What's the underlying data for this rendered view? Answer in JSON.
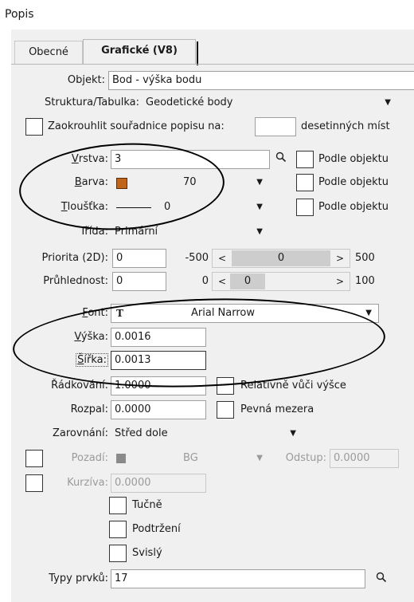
{
  "window": {
    "title": "Popis"
  },
  "tabs": [
    {
      "label": "Obecné"
    },
    {
      "label": "Grafické (V8)"
    }
  ],
  "objekt": {
    "label": "Objekt:",
    "value": "Bod - výška bodu"
  },
  "struktura": {
    "label": "Struktura/Tabulka:",
    "value": "Geodetické body"
  },
  "zaokrouhlit": {
    "label": "Zaokrouhlit souřadnice popisu na:",
    "value": "",
    "suffix": "desetinných míst"
  },
  "vrstva": {
    "label_u": "V",
    "label_rest": "rstva:",
    "value": "3",
    "podle": "Podle objektu"
  },
  "barva": {
    "label_u": "B",
    "label_rest": "arva:",
    "value": "70",
    "swatch_color": "#c0651a",
    "podle": "Podle objektu"
  },
  "tloustka": {
    "label_u": "T",
    "label_rest": "loušťka:",
    "value": "0",
    "podle": "Podle objektu"
  },
  "trida": {
    "label": "Třída:",
    "value": "Primární"
  },
  "priorita": {
    "label": "Priorita (2D):",
    "value": "0",
    "min": "-500",
    "max": "500",
    "slider": "0",
    "left": "<",
    "right": ">"
  },
  "pruhlednost": {
    "label": "Průhlednost:",
    "value": "0",
    "min": "0",
    "max": "100",
    "slider": "0",
    "left": "<",
    "right": ">"
  },
  "font": {
    "label_u": "F",
    "label_rest": "ont:",
    "value": "Arial Narrow",
    "icon": "truetype-font-icon"
  },
  "vyska": {
    "label_u": "V",
    "label_rest": "ýška:",
    "value": "0.0016"
  },
  "sirka": {
    "label_u": "Š",
    "label_rest": "ířka:",
    "value": "0.0013"
  },
  "radkovani": {
    "label": "Řádkování:",
    "value": "1.0000",
    "relativne": "Relativně vůči výšce"
  },
  "rozpal": {
    "label": "Rozpal:",
    "value": "0.0000",
    "pevna": "Pevná mezera"
  },
  "zarovnani": {
    "label": "Zarovnání:",
    "value": "Střed dole"
  },
  "pozadi": {
    "label": "Pozadí:",
    "value": "BG",
    "odstup_label": "Odstup:",
    "odstup_value": "0.0000"
  },
  "kurziva": {
    "label": "Kurzíva:",
    "value": "0.0000"
  },
  "styles": {
    "tucne": "Tučně",
    "podtrzeni": "Podtržení",
    "svisly": "Svislý"
  },
  "typy": {
    "label": "Typy prvků:",
    "value": "17"
  }
}
